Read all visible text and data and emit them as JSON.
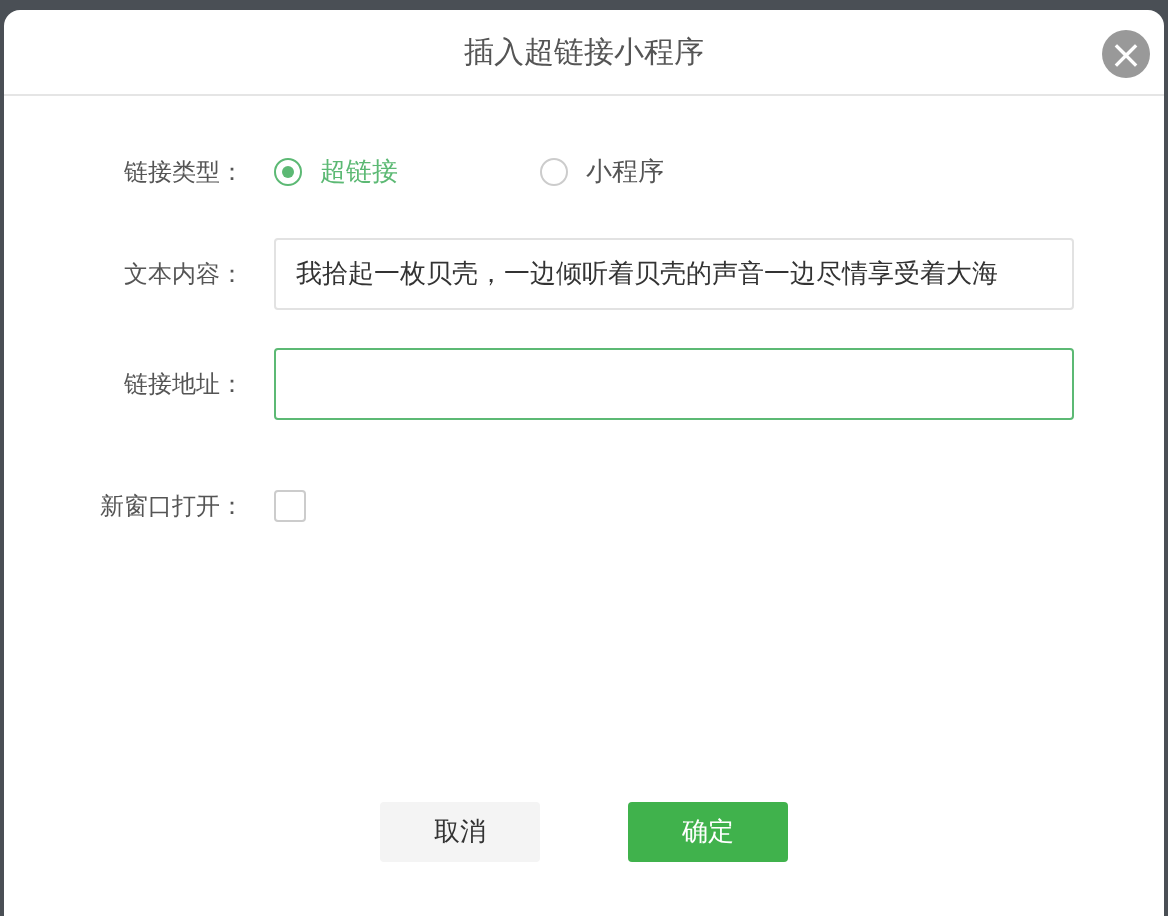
{
  "dialog": {
    "title": "插入超链接小程序",
    "close": "×"
  },
  "fields": [
    {
      "kind": "radio",
      "label": "链接类型：",
      "options": [
        {
          "label": "超链接",
          "selected": true
        },
        {
          "label": "小程序",
          "selected": false
        }
      ]
    },
    {
      "kind": "text",
      "label": "文本内容：",
      "value": "我拾起一枚贝壳，一边倾听着贝壳的声音一边尽情享受着大海",
      "focused": false
    },
    {
      "kind": "text",
      "label": "链接地址：",
      "focused": true
    },
    {
      "kind": "checkbox",
      "label": "新窗口打开：",
      "checked": false
    }
  ],
  "buttons": [
    {
      "label": "取消",
      "kind": "secondary"
    },
    {
      "label": "确定",
      "kind": "primary"
    }
  ]
}
